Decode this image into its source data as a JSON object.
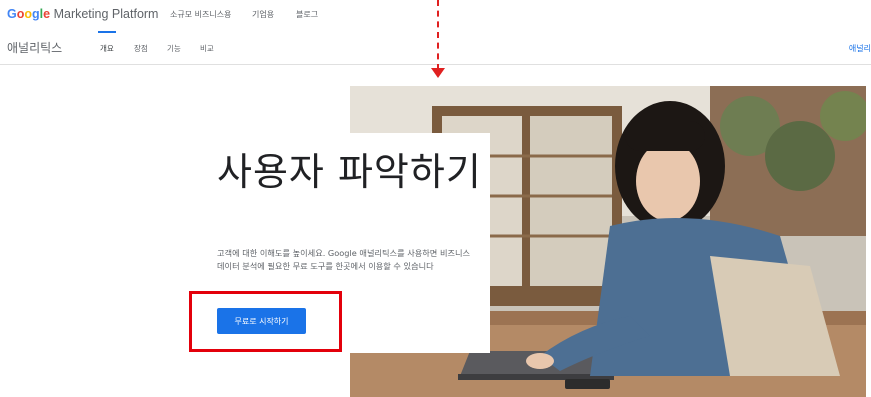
{
  "header": {
    "logo_google": "Google",
    "logo_product": "Marketing Platform",
    "nav": [
      "소규모 비즈니스용",
      "기업용",
      "블로그"
    ]
  },
  "subnav": {
    "product": "애널리틱스",
    "tabs": [
      "개요",
      "장점",
      "기능",
      "비교"
    ],
    "active_tab_index": 0,
    "right_link": "애널리"
  },
  "hero": {
    "title": "사용자 파악하기",
    "description": "고객에 대한 이해도를 높이세요. Google 애널리틱스를 사용하면 비즈니스 데이터 분석에 필요한 무료 도구를 한곳에서 이용할 수 있습니다",
    "cta": "무료로 시작하기"
  },
  "colors": {
    "accent": "#1a73e8",
    "annotation": "#e3000b"
  }
}
